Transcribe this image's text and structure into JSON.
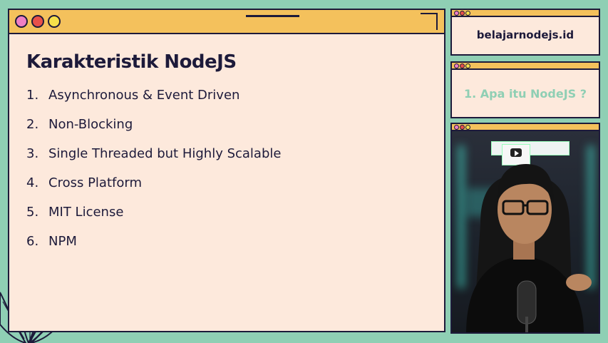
{
  "main": {
    "title": "Karakteristik NodeJS",
    "items": [
      {
        "num": "1.",
        "text": "Asynchronous & Event Driven"
      },
      {
        "num": "2.",
        "text": "Non-Blocking"
      },
      {
        "num": "3.",
        "text": "Single Threaded but Highly Scalable"
      },
      {
        "num": "4.",
        "text": "Cross Platform"
      },
      {
        "num": "5.",
        "text": "MIT License"
      },
      {
        "num": "6.",
        "text": "NPM"
      }
    ]
  },
  "sidebar": {
    "site": "belajarnodejs.id",
    "chapter": "1. Apa itu NodeJS ?"
  },
  "colors": {
    "dot_pink": "#ef7fc4",
    "dot_red": "#e8504a",
    "dot_yellow": "#f6e04a",
    "bar": "#f4c15c",
    "panel": "#fde9dc",
    "accent": "#8fcfb4",
    "ink": "#1d1a3a"
  },
  "icons": {
    "plant": "leaf-plant-decoration",
    "camera": "webcam-presenter"
  }
}
